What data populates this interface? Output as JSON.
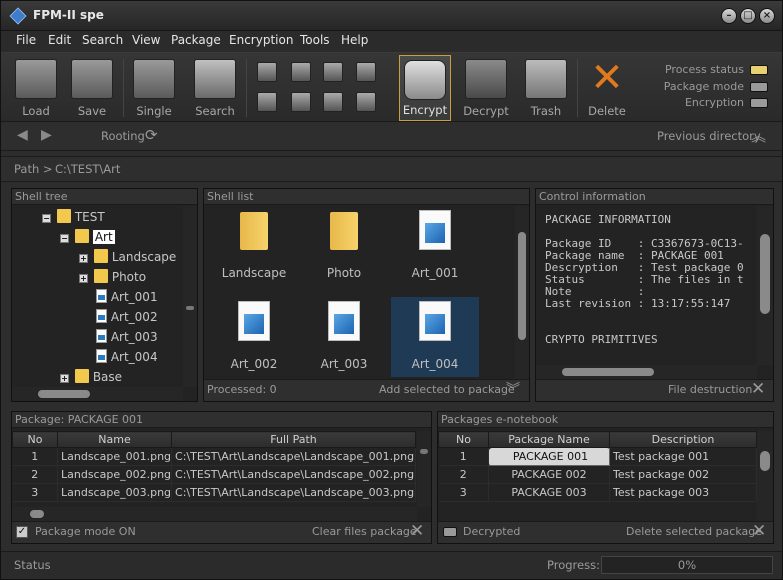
{
  "window": {
    "title": "FPM-II spe"
  },
  "menu": [
    "File",
    "Edit",
    "Search",
    "View",
    "Package",
    "Encryption",
    "Tools",
    "Help"
  ],
  "toolbar": {
    "load": "Load",
    "save": "Save",
    "single": "Single",
    "search": "Search",
    "encrypt": "Encrypt",
    "decrypt": "Decrypt",
    "trash": "Trash",
    "delete": "Delete"
  },
  "indicators": {
    "process": "Process status",
    "mode": "Package mode",
    "encryption": "Encryption",
    "colors": {
      "process": "#e6d070",
      "mode": "#9a9a9a",
      "encryption": "#9a9a9a"
    }
  },
  "nav": {
    "rooting": "Rooting",
    "previous": "Previous directory"
  },
  "path": {
    "label": "Path >",
    "value": "C:\\TEST\\Art"
  },
  "shell_tree": {
    "title": "Shell tree",
    "items": [
      "TEST",
      "Art",
      "Landscape",
      "Photo",
      "Art_001",
      "Art_002",
      "Art_003",
      "Art_004",
      "Base"
    ]
  },
  "shell_list": {
    "title": "Shell list",
    "items": [
      "Landscape",
      "Photo",
      "Art_001",
      "Art_002",
      "Art_003",
      "Art_004"
    ],
    "processed": "Processed: 0",
    "add": "Add selected to package"
  },
  "control": {
    "title": "Control information",
    "lines": [
      "PACKAGE INFORMATION",
      "",
      "Package ID    : C3367673-0C13-",
      "Package name  : PACKAGE 001",
      "Descryption   : Test package 0",
      "Status        : The files in t",
      "Note          :",
      "Last revision : 13:17:55:147",
      "",
      "",
      "CRYPTO PRIMITIVES"
    ],
    "footer": "File destruction"
  },
  "package": {
    "title": "Package: PACKAGE 001",
    "headers": [
      "No",
      "Name",
      "Full Path"
    ],
    "rows": [
      [
        "1",
        "Landscape_001.png",
        "C:\\TEST\\Art\\Landscape\\Landscape_001.png"
      ],
      [
        "2",
        "Landscape_002.png",
        "C:\\TEST\\Art\\Landscape\\Landscape_002.png"
      ],
      [
        "3",
        "Landscape_003.png",
        "C:\\TEST\\Art\\Landscape\\Landscape_003.png"
      ]
    ],
    "mode_on": "Package mode ON",
    "clear": "Clear files package"
  },
  "notebook": {
    "title": "Packages e-notebook",
    "headers": [
      "No",
      "Package Name",
      "Description"
    ],
    "rows": [
      [
        "1",
        "PACKAGE 001",
        "Test package 001"
      ],
      [
        "2",
        "PACKAGE 002",
        "Test package 002"
      ],
      [
        "3",
        "PACKAGE 003",
        "Test package 003"
      ]
    ],
    "decrypted": "Decrypted",
    "delete": "Delete selected  package"
  },
  "status": {
    "label": "Status",
    "progress_label": "Progress:",
    "progress": "0%"
  }
}
